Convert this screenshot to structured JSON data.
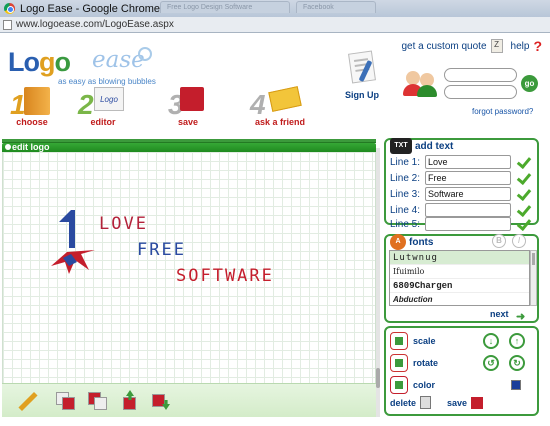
{
  "window": {
    "title": "Logo Ease - Google Chrome",
    "bg_tabs": [
      "Free Logo Design Software",
      "Facebook"
    ],
    "url": "www.logoease.com/LogoEase.aspx"
  },
  "header": {
    "brand": {
      "part1": "Lo",
      "part2": "g",
      "part3": "o",
      "part4": "ease"
    },
    "tagline": "as easy as blowing bubbles",
    "custom_quote_link": "get a custom quote",
    "help_link": "help",
    "signup_label": "Sign Up",
    "forgot_password": "forgot password?",
    "go_label": "go"
  },
  "nav": {
    "items": [
      {
        "num": "1",
        "label": "choose"
      },
      {
        "num": "2",
        "label": "editor"
      },
      {
        "num": "3",
        "label": "save"
      },
      {
        "num": "4",
        "label": "ask a friend"
      }
    ]
  },
  "editor": {
    "panel_title": "edit logo",
    "logo_words": [
      "LOVE",
      "FREE",
      "SOFTWARE"
    ]
  },
  "add_text": {
    "title": "add text",
    "lines": [
      {
        "label": "Line 1:",
        "value": "Love"
      },
      {
        "label": "Line 2:",
        "value": "Free"
      },
      {
        "label": "Line 3:",
        "value": "Software"
      },
      {
        "label": "Line 4:",
        "value": ""
      },
      {
        "label": "Line 5:",
        "value": ""
      }
    ]
  },
  "fonts": {
    "title": "fonts",
    "items": [
      "Lutwnug",
      "Ifuimilo",
      "6809Chargen",
      "Abduction"
    ],
    "next_label": "next"
  },
  "controls": {
    "scale_label": "scale",
    "rotate_label": "rotate",
    "color_label": "color",
    "delete_label": "delete",
    "save_label": "save"
  },
  "colors": {
    "accent_green": "#3c9a3c",
    "link_blue": "#0b3f82",
    "nav_red": "#c01c1c",
    "logo_red": "#c41e2c",
    "logo_blue": "#2a4aa0"
  }
}
